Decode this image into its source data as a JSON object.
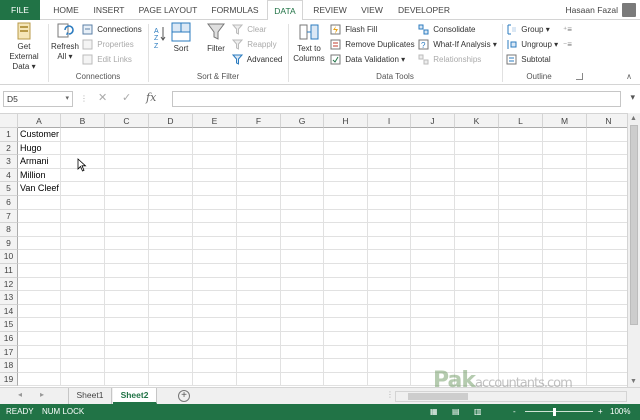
{
  "ribbon_tabs": [
    "FILE",
    "HOME",
    "INSERT",
    "PAGE LAYOUT",
    "FORMULAS",
    "DATA",
    "REVIEW",
    "VIEW",
    "DEVELOPER"
  ],
  "active_tab": "DATA",
  "user_name": "Hasaan Fazal",
  "groups": {
    "get_external": {
      "label1": "Get External",
      "label2": "Data"
    },
    "connections": {
      "refresh1": "Refresh",
      "refresh2": "All",
      "connections": "Connections",
      "properties": "Properties",
      "edit_links": "Edit Links",
      "label": "Connections"
    },
    "sort_filter": {
      "sort": "Sort",
      "filter": "Filter",
      "clear": "Clear",
      "reapply": "Reapply",
      "advanced": "Advanced",
      "label": "Sort & Filter"
    },
    "data_tools": {
      "text_to1": "Text to",
      "text_to2": "Columns",
      "flash_fill": "Flash Fill",
      "remove_duplicates": "Remove Duplicates",
      "data_validation": "Data Validation",
      "consolidate": "Consolidate",
      "what_if": "What-If Analysis",
      "relationships": "Relationships",
      "label": "Data Tools"
    },
    "outline": {
      "group": "Group",
      "ungroup": "Ungroup",
      "subtotal": "Subtotal",
      "label": "Outline"
    }
  },
  "name_box": "D5",
  "formula_value": "",
  "fx_label": "fx",
  "columns": [
    "A",
    "B",
    "C",
    "D",
    "E",
    "F",
    "G",
    "H",
    "I",
    "J",
    "K",
    "L",
    "M",
    "N"
  ],
  "rows": [
    "1",
    "2",
    "3",
    "4",
    "5",
    "6",
    "7",
    "8",
    "9",
    "10",
    "11",
    "12",
    "13",
    "14",
    "15",
    "16",
    "17",
    "18",
    "19"
  ],
  "cells_A": [
    "Customer",
    "Hugo",
    "Armani",
    "Million",
    "Van Cleef"
  ],
  "sheets": [
    "Sheet1",
    "Sheet2"
  ],
  "active_sheet": "Sheet2",
  "watermark": {
    "brand": "Pak",
    "rest": "accountants.com"
  },
  "status": {
    "ready": "READY",
    "numlock": "NUM LOCK",
    "zoom": "100%",
    "minus": "-",
    "plus": "+"
  },
  "colors": {
    "accent": "#217346",
    "header_bg": "#f3f3f3",
    "grid_line": "#e1e1e1"
  }
}
